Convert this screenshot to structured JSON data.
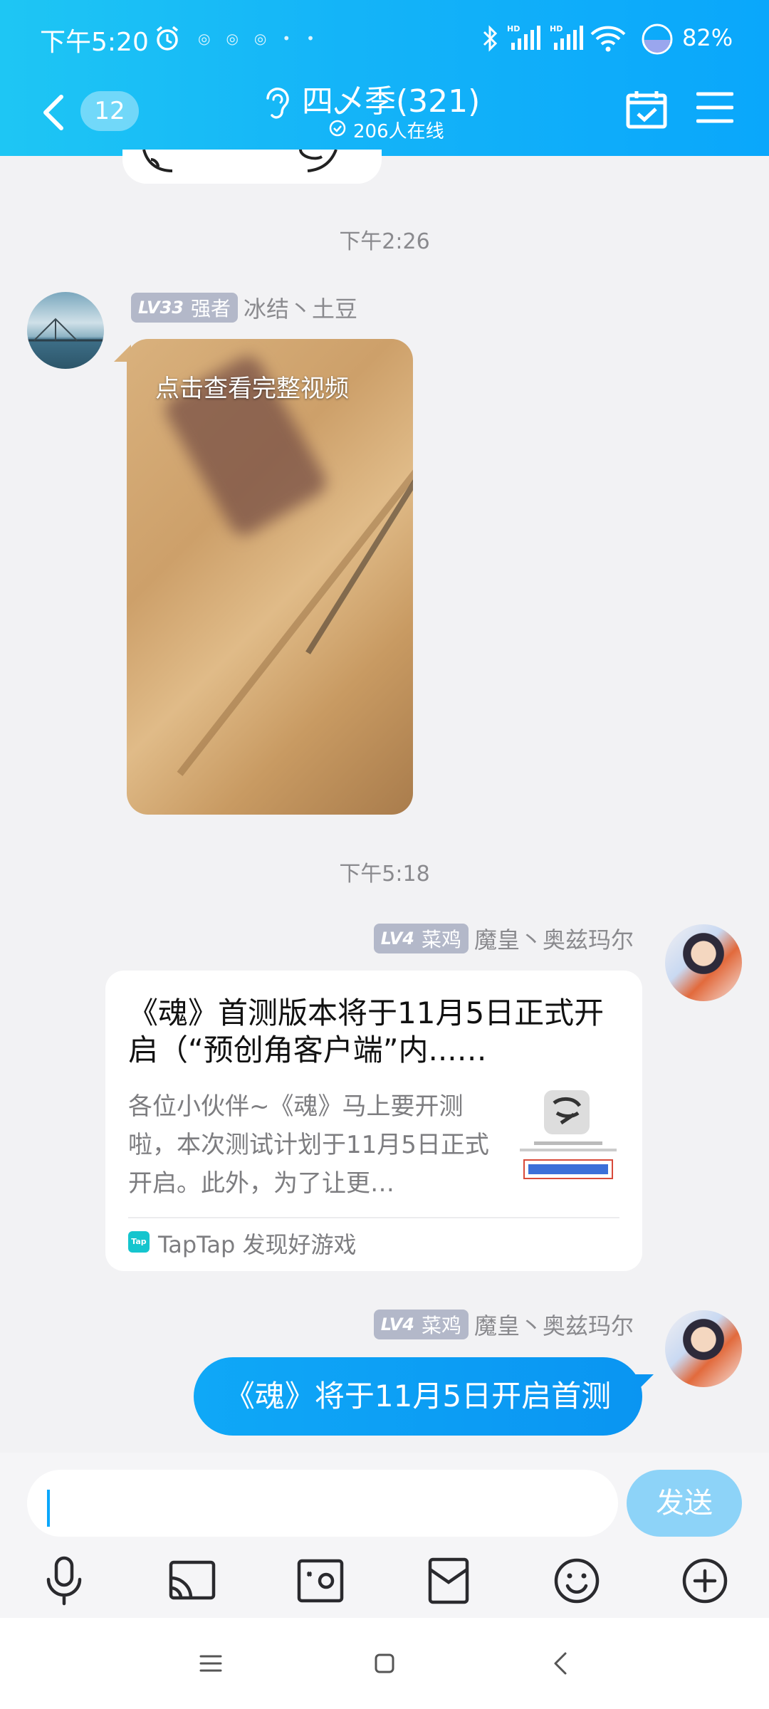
{
  "status_bar": {
    "time": "下午5:20",
    "battery": "82%"
  },
  "header": {
    "unread_count": "12",
    "group_name": "四乄季(321)",
    "online": "206人在线"
  },
  "messages": {
    "timestamp_1": "下午2:26",
    "msg1": {
      "level": "LV33",
      "title": "强者",
      "name": "冰结丶土豆",
      "video_caption": "点击查看完整视频"
    },
    "timestamp_2": "下午5:18",
    "msg2": {
      "level": "LV4",
      "title": "菜鸡",
      "name": "魔皇丶奥兹玛尔",
      "card_title": "《魂》首测版本将于11月5日正式开启（“预创角客户端”内...…",
      "card_desc": "各位小伙伴~《魂》马上要开测啦，本次测试计划于11月5日正式开启。此外，为了让更…",
      "card_source": "TapTap 发现好游戏",
      "source_icon": "Tap"
    },
    "msg3": {
      "level": "LV4",
      "title": "菜鸡",
      "name": "魔皇丶奥兹玛尔",
      "text": "《魂》将于11月5日开启首测"
    }
  },
  "input": {
    "value": "",
    "send_label": "发送"
  },
  "colors": {
    "header": "#14b4f8",
    "accent": "#0aa7fb",
    "background": "#f2f2f4"
  }
}
